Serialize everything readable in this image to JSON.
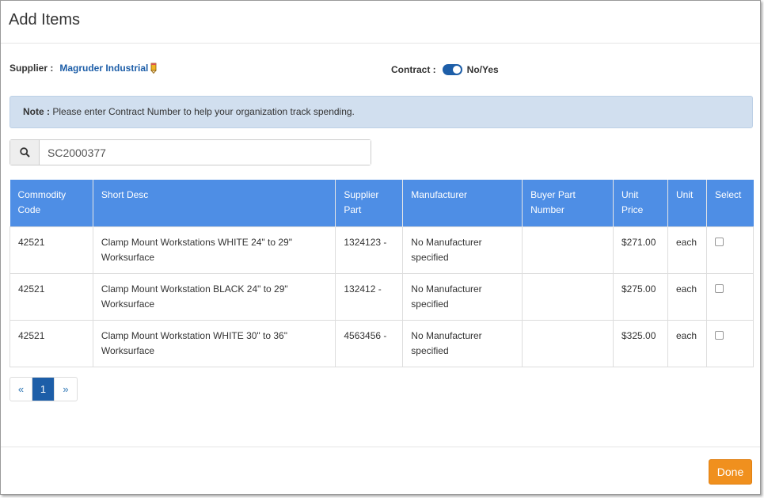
{
  "dialog": {
    "title": "Add Items"
  },
  "supplier": {
    "label": "Supplier :",
    "name": "Magruder Industrial"
  },
  "contract": {
    "label": "Contract :",
    "toggle_label": "No/Yes",
    "value": true
  },
  "note": {
    "label": "Note :",
    "text": "Please enter Contract Number to help your organization track spending."
  },
  "search": {
    "value": "SC2000377"
  },
  "table": {
    "headers": {
      "commodity_code": "Commodity Code",
      "short_desc": "Short Desc",
      "supplier_part": "Supplier Part",
      "manufacturer": "Manufacturer",
      "buyer_part": "Buyer Part Number",
      "unit_price": "Unit Price",
      "unit": "Unit",
      "select": "Select"
    },
    "rows": [
      {
        "commodity_code": "42521",
        "short_desc": "Clamp Mount Workstations WHITE 24\" to 29\" Worksurface",
        "supplier_part": "1324123 -",
        "manufacturer": "No Manufacturer specified",
        "buyer_part": "",
        "unit_price": "$271.00",
        "unit": "each",
        "selected": false
      },
      {
        "commodity_code": "42521",
        "short_desc": "Clamp Mount Workstation BLACK 24\" to 29\" Worksurface",
        "supplier_part": "132412 -",
        "manufacturer": "No Manufacturer specified",
        "buyer_part": "",
        "unit_price": "$275.00",
        "unit": "each",
        "selected": false
      },
      {
        "commodity_code": "42521",
        "short_desc": "Clamp Mount Workstation WHITE 30\" to 36\" Worksurface",
        "supplier_part": "4563456 -",
        "manufacturer": "No Manufacturer specified",
        "buyer_part": "",
        "unit_price": "$325.00",
        "unit": "each",
        "selected": false
      }
    ]
  },
  "pagination": {
    "prev": "«",
    "current": "1",
    "next": "»"
  },
  "footer": {
    "done_label": "Done"
  },
  "colors": {
    "header_blue": "#4e8ee5",
    "accent": "#1d5ea8",
    "done": "#f0901e",
    "note_bg": "#d1dfef"
  }
}
